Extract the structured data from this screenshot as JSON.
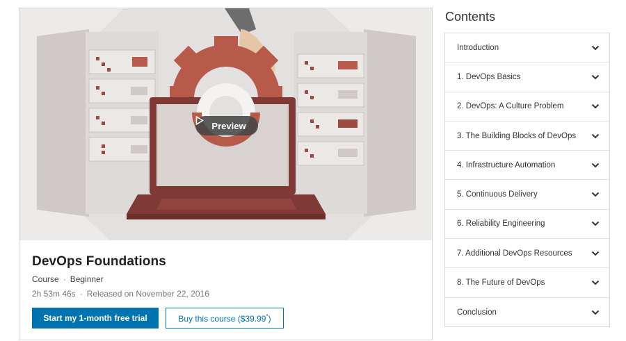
{
  "hero": {
    "preview_label": "Preview",
    "colors": {
      "background": "#ecebea",
      "accent_red": "#b85a4a",
      "laptop": "#7f3a36",
      "server": "#d6d2d0"
    }
  },
  "course": {
    "title": "DevOps Foundations",
    "type": "Course",
    "level": "Beginner",
    "duration": "2h 53m 46s",
    "released": "Released on November 22, 2016"
  },
  "actions": {
    "trial_label": "Start my 1-month free trial",
    "buy_label": "Buy this course ($39.99",
    "buy_suffix": ")",
    "buy_mark": "*"
  },
  "contents": {
    "heading": "Contents",
    "items": [
      {
        "label": "Introduction"
      },
      {
        "label": "1. DevOps Basics"
      },
      {
        "label": "2. DevOps: A Culture Problem"
      },
      {
        "label": "3. The Building Blocks of DevOps"
      },
      {
        "label": "4. Infrastructure Automation"
      },
      {
        "label": "5. Continuous Delivery"
      },
      {
        "label": "6. Reliability Engineering"
      },
      {
        "label": "7. Additional DevOps Resources"
      },
      {
        "label": "8. The Future of DevOps"
      },
      {
        "label": "Conclusion"
      }
    ]
  },
  "colors": {
    "primary": "#0073b1"
  }
}
